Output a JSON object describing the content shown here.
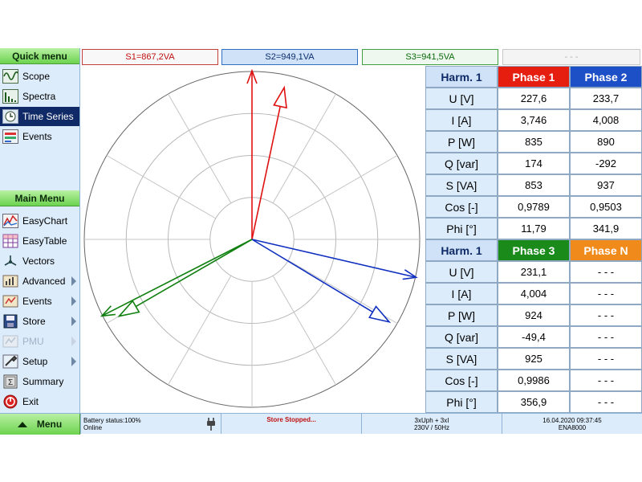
{
  "top_bar": {
    "s1": "S1=867,2VA",
    "s2": "S2=949,1VA",
    "s3": "S3=941,5VA",
    "s4": "- - -"
  },
  "sidebar": {
    "quick_menu_title": "Quick menu",
    "quick_items": [
      {
        "label": "Scope",
        "icon": "scope-icon"
      },
      {
        "label": "Spectra",
        "icon": "spectra-icon"
      },
      {
        "label": "Time Series",
        "icon": "time-series-icon",
        "active": true
      },
      {
        "label": "Events",
        "icon": "events-icon"
      }
    ],
    "main_menu_title": "Main Menu",
    "main_items": [
      {
        "label": "EasyChart",
        "icon": "easychart-icon"
      },
      {
        "label": "EasyTable",
        "icon": "easytable-icon"
      },
      {
        "label": "Vectors",
        "icon": "vectors-icon"
      },
      {
        "label": "Advanced",
        "icon": "advanced-icon",
        "submenu": true
      },
      {
        "label": "Events",
        "icon": "events-icon",
        "submenu": true
      },
      {
        "label": "Store",
        "icon": "store-icon",
        "submenu": true
      },
      {
        "label": "PMU",
        "icon": "pmu-icon",
        "submenu": true,
        "disabled": true
      },
      {
        "label": "Setup",
        "icon": "setup-icon",
        "submenu": true
      },
      {
        "label": "Summary",
        "icon": "summary-icon"
      },
      {
        "label": "Exit",
        "icon": "exit-icon"
      }
    ]
  },
  "vectors": [
    {
      "name": "U1",
      "color": "#e01010",
      "angle_deg": 90,
      "length": 1.0
    },
    {
      "name": "I1",
      "color": "#e01010",
      "angle_deg": 78,
      "length": 0.92
    },
    {
      "name": "U2",
      "color": "#1030c0",
      "angle_deg": -13,
      "length": 1.0
    },
    {
      "name": "I2",
      "color": "#1030c0",
      "angle_deg": -31,
      "length": 0.95
    },
    {
      "name": "U3",
      "color": "#108010",
      "angle_deg": 207,
      "length": 1.0
    },
    {
      "name": "I3",
      "color": "#108010",
      "angle_deg": 210,
      "length": 0.91
    }
  ],
  "table": {
    "top": {
      "harm": "Harm. 1",
      "phase_a": "Phase 1",
      "phase_b": "Phase 2",
      "rows": [
        {
          "label": "U [V]",
          "a": "227,6",
          "b": "233,7"
        },
        {
          "label": "I [A]",
          "a": "3,746",
          "b": "4,008"
        },
        {
          "label": "P [W]",
          "a": "835",
          "b": "890"
        },
        {
          "label": "Q [var]",
          "a": "174",
          "b": "-292"
        },
        {
          "label": "S [VA]",
          "a": "853",
          "b": "937"
        },
        {
          "label": "Cos [-]",
          "a": "0,9789",
          "b": "0,9503"
        },
        {
          "label": "Phi [°]",
          "a": "11,79",
          "b": "341,9"
        }
      ]
    },
    "bottom": {
      "harm": "Harm. 1",
      "phase_a": "Phase 3",
      "phase_b": "Phase N",
      "rows": [
        {
          "label": "U [V]",
          "a": "231,1",
          "b": "- - -"
        },
        {
          "label": "I [A]",
          "a": "4,004",
          "b": "- - -"
        },
        {
          "label": "P [W]",
          "a": "924",
          "b": "- - -"
        },
        {
          "label": "Q [var]",
          "a": "-49,4",
          "b": "- - -"
        },
        {
          "label": "S [VA]",
          "a": "925",
          "b": "- - -"
        },
        {
          "label": "Cos [-]",
          "a": "0,9986",
          "b": "- - -"
        },
        {
          "label": "Phi [°]",
          "a": "356,9",
          "b": "- - -"
        }
      ]
    }
  },
  "bottom_bar": {
    "menu_label": "Menu",
    "battery": "Battery status:100%",
    "online": "Online",
    "store_status": "Store Stopped...",
    "mode_line1": "3xUph + 3xI",
    "mode_line2": "230V / 50Hz",
    "datetime": "16.04.2020 09:37:45",
    "device": "ENA8000"
  },
  "colors": {
    "phase1": "#e51e10",
    "phase2": "#1d4fc6",
    "phase3": "#1a8a1a",
    "phaseN": "#f08a1a",
    "store_status": "#c01010"
  }
}
